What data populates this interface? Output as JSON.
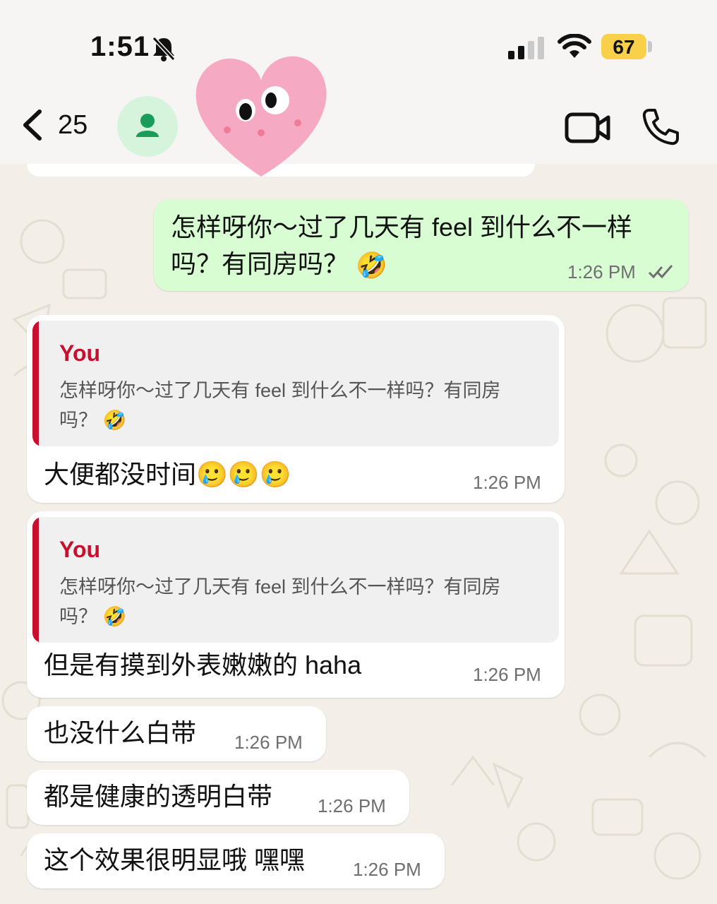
{
  "status": {
    "time": "1:51",
    "battery": "67"
  },
  "header": {
    "back_count": "25"
  },
  "icons": {
    "bell": "bell-slash-icon",
    "signal": "cellular-signal-icon",
    "wifi": "wifi-icon",
    "back": "chevron-left-icon",
    "avatar": "person-icon",
    "video": "video-camera-icon",
    "call": "phone-icon",
    "read": "double-check-icon",
    "sticker": "pink-heart-sticker"
  },
  "colors": {
    "outgoing_bubble": "#d9fdd3",
    "incoming_bubble": "#ffffff",
    "quote_accent": "#c8102e",
    "battery": "#f8d04a",
    "avatar_bg": "#d6f3dc",
    "avatar_icon": "#1a9c5b"
  },
  "messages": {
    "m1": {
      "line1": "怎样呀你～过了几天有 feel 到什么不一样",
      "line2": "吗？有同房吗？",
      "emoji": "🤣",
      "time": "1:26 PM"
    },
    "m2": {
      "quote_author": "You",
      "quote_line1": "怎样呀你～过了几天有 feel 到什么不一样吗？有同房",
      "quote_line2": "吗？",
      "quote_emoji": "🤣",
      "text": "大便都没时间",
      "emojis": "🥲🥲🥲",
      "time": "1:26 PM"
    },
    "m3": {
      "quote_author": "You",
      "quote_line1": "怎样呀你～过了几天有 feel 到什么不一样吗？有同房",
      "quote_line2": "吗？",
      "quote_emoji": "🤣",
      "text": "但是有摸到外表嫩嫩的 haha",
      "time": "1:26 PM"
    },
    "m4": {
      "text": "也没什么白带",
      "time": "1:26 PM"
    },
    "m5": {
      "text": "都是健康的透明白带",
      "time": "1:26 PM"
    },
    "m6": {
      "text": "这个效果很明显哦 嘿嘿",
      "time": "1:26 PM"
    }
  }
}
